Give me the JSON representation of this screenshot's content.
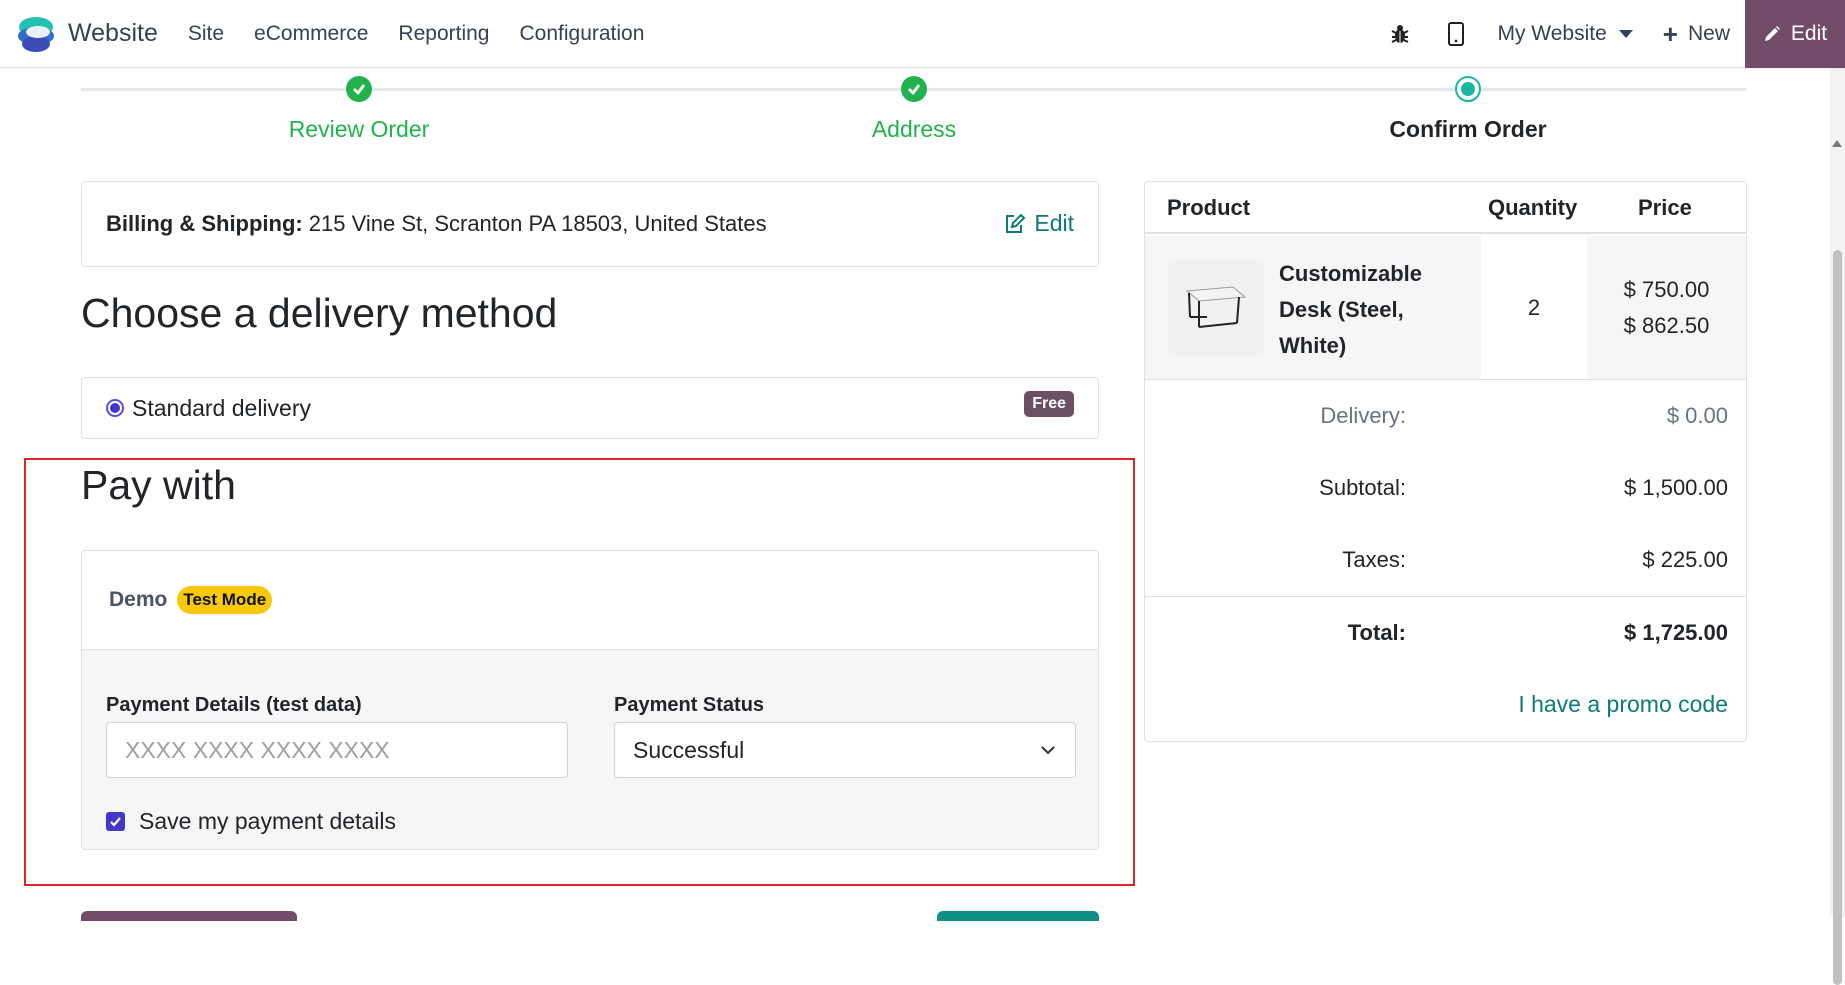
{
  "navbar": {
    "app_name": "Website",
    "menu": [
      "Site",
      "eCommerce",
      "Reporting",
      "Configuration"
    ],
    "website_selector": "My Website",
    "new_label": "New",
    "edit_label": "Edit",
    "colors": {
      "edit_bg": "#714b67"
    }
  },
  "wizard": {
    "steps": [
      {
        "label": "Review Order",
        "state": "done"
      },
      {
        "label": "Address",
        "state": "done"
      },
      {
        "label": "Confirm Order",
        "state": "current"
      }
    ],
    "colors": {
      "done": "#22b14c",
      "current": "#1ab5a5"
    }
  },
  "address": {
    "label": "Billing & Shipping:",
    "value": "215 Vine St, Scranton PA 18503, United States",
    "edit_label": "Edit"
  },
  "delivery": {
    "heading": "Choose a delivery method",
    "option_label": "Standard delivery",
    "price_badge": "Free"
  },
  "payment": {
    "heading": "Pay with",
    "provider": "Demo",
    "mode_badge": "Test Mode",
    "details_label": "Payment Details (test data)",
    "details_placeholder": "XXXX XXXX XXXX XXXX",
    "status_label": "Payment Status",
    "status_value": "Successful",
    "save_label": "Save my payment details",
    "save_checked": true
  },
  "summary": {
    "headers": {
      "product": "Product",
      "quantity": "Quantity",
      "price": "Price"
    },
    "item": {
      "name": "Customizable Desk (Steel, White)",
      "quantity": "2",
      "unit_price": "$ 750.00",
      "line_price": "$ 862.50"
    },
    "delivery_label": "Delivery:",
    "delivery_value": "$ 0.00",
    "subtotal_label": "Subtotal:",
    "subtotal_value": "$ 1,500.00",
    "taxes_label": "Taxes:",
    "taxes_value": "$ 225.00",
    "total_label": "Total:",
    "total_value": "$ 1,725.00",
    "promo_label": "I have a promo code"
  }
}
